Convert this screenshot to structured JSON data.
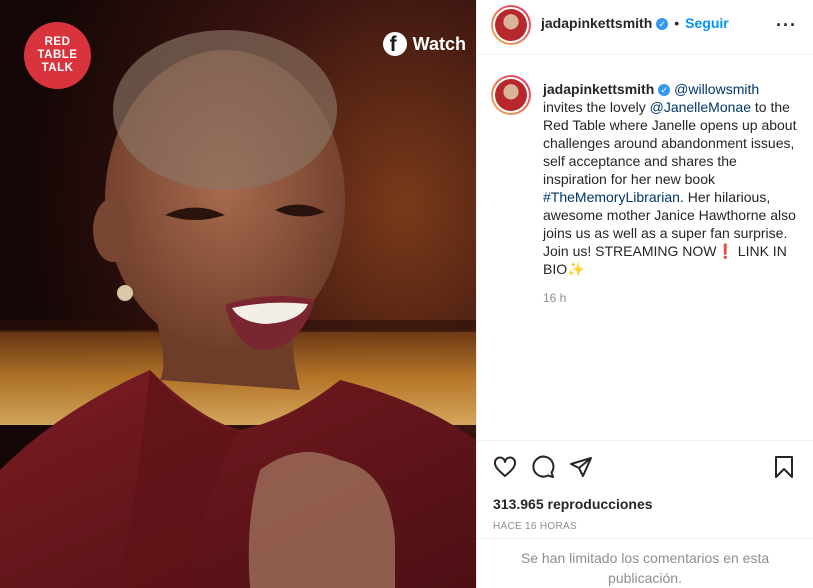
{
  "media": {
    "logo_lines": [
      "RED",
      "TABLE",
      "TALK"
    ],
    "watch_label": "Watch",
    "icon": "facebook-icon"
  },
  "header": {
    "username": "jadapinkettsmith",
    "follow_label": "Seguir",
    "more_icon": "more-options-icon"
  },
  "caption": {
    "username": "jadapinkettsmith",
    "mention_1": "@willowsmith",
    "text_1": " invites the lovely ",
    "mention_2": "@JanelleMonae",
    "text_2": " to the Red Table where Janelle opens up about challenges around abandonment issues, self acceptance and shares the inspiration for her new book ",
    "hashtag": "#TheMemoryLibrarian",
    "text_3": ". Her hilarious, awesome mother Janice Hawthorne also joins us as well as a super fan surprise. Join us! STREAMING NOW",
    "emoji_1": "❗",
    "text_4": " LINK IN BIO",
    "emoji_2": "✨",
    "time": "16 h"
  },
  "actions": {
    "views": "313.965 reproducciones",
    "posted_ago": "HACE 16 HORAS",
    "icons": [
      "heart-icon",
      "comment-icon",
      "share-icon",
      "bookmark-icon"
    ]
  },
  "comments": {
    "limited_text": "Se han limitado los comentarios en esta publicación."
  },
  "colors": {
    "brand_red": "#d9333d",
    "link_blue": "#00376b",
    "follow_blue": "#0095f6"
  }
}
